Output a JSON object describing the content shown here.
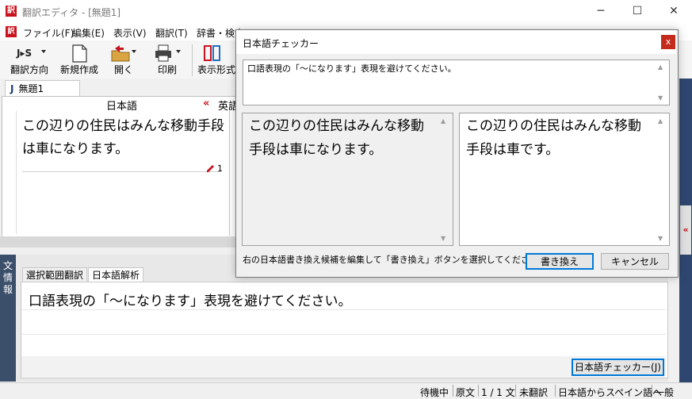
{
  "window": {
    "title": "翻訳エディタ - [無題1]",
    "app_icon_glyph": "訳",
    "minimize": "─",
    "maximize": "☐",
    "close": "✕"
  },
  "menu": {
    "icon_glyph": "訳",
    "items": [
      "ファイル(F)",
      "編集(E)",
      "表示(V)",
      "翻訳(T)",
      "辞書・検索"
    ]
  },
  "toolbar": {
    "direction_icon_text": "J▸S",
    "direction_label": "翻訳方向",
    "new_label": "新規作成",
    "open_label": "開く",
    "print_label": "印刷",
    "display_label": "表示形式"
  },
  "document": {
    "tab_icon": "J",
    "tab_label": "無題1",
    "source_header": "日本語",
    "target_header_arrow": "«",
    "target_header": "英語",
    "source_text": "この辺りの住民はみんな移動手段は車になります。",
    "sentence_number": "1"
  },
  "info_panel": {
    "side_label": "文情報",
    "tabs": [
      "選択範囲翻訳",
      "日本語解析"
    ],
    "message": "口語表現の「～になります」表現を避けてください。",
    "checker_button": "日本語チェッカー(J)"
  },
  "dialog": {
    "title": "日本語チェッカー",
    "close_glyph": "x",
    "message": "口語表現の「～になります」表現を避けてください。",
    "original_text": "この辺りの住民はみんな移動手段は車になります。",
    "suggested_text": "この辺りの住民はみんな移動手段は車です。",
    "instruction": "右の日本語書き換え候補を編集して「書き換え」ボタンを選択してください。",
    "rewrite_button": "書き換え",
    "cancel_button": "キャンセル"
  },
  "side_collapse_glyph": "«",
  "status": {
    "state": "待機中",
    "mode": "原文",
    "position": "1 / 1 文",
    "translation_state": "未翻訳",
    "direction": "日本語からスペイン語へ",
    "category": "一般"
  },
  "colors": {
    "accent_red": "#c8141e",
    "side_panel": "#3c4f6a",
    "right_bar": "#2f4770",
    "dialog_close": "#c42b1c",
    "primary_border": "#0078d7"
  }
}
